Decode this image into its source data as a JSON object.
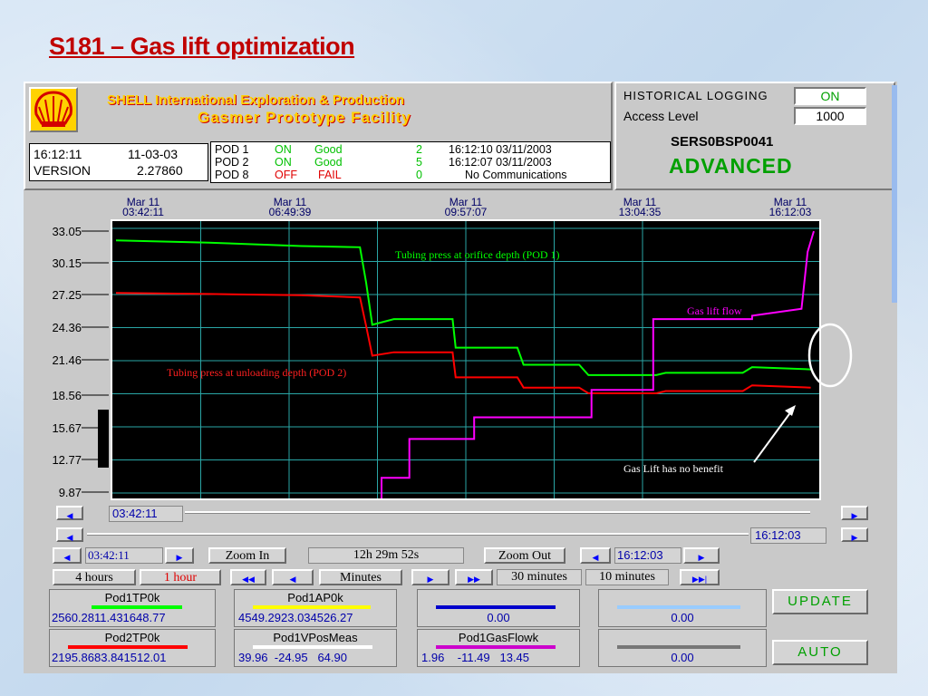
{
  "slide": {
    "title": "S181 – Gas lift optimization"
  },
  "header": {
    "company_line1": "SHELL International Exploration & Production",
    "company_line2": "Gasmer Prototype Facility",
    "time": "16:12:11",
    "date": "11-03-03",
    "version_label": "VERSION",
    "version_value": "2.27860",
    "pods": [
      {
        "name": "POD 1",
        "state": "ON",
        "quality": "Good",
        "count": "2",
        "stamp": "16:12:10 03/11/2003",
        "state_color": "#00c000",
        "quality_color": "#00c000"
      },
      {
        "name": "POD 2",
        "state": "ON",
        "quality": "Good",
        "count": "5",
        "stamp": "16:12:07 03/11/2003",
        "state_color": "#00c000",
        "quality_color": "#00c000"
      },
      {
        "name": "POD 8",
        "state": "OFF",
        "quality": "FAIL",
        "count": "0",
        "stamp": "No Communications",
        "state_color": "#e00000",
        "quality_color": "#e00000"
      }
    ],
    "historical_logging_label": "HISTORICAL LOGGING",
    "historical_logging_value": "ON",
    "access_level_label": "Access Level",
    "access_level_value": "1000",
    "station_id": "SERS0BSP0041",
    "mode": "ADVANCED"
  },
  "chart": {
    "y_ticks": [
      "33.05",
      "30.15",
      "27.25",
      "24.36",
      "21.46",
      "18.56",
      "15.67",
      "12.77",
      "9.87"
    ],
    "x_ticks": [
      {
        "date": "Mar 11",
        "time": "03:42:11"
      },
      {
        "date": "Mar 11",
        "time": "06:49:39"
      },
      {
        "date": "Mar 11",
        "time": "09:57:07"
      },
      {
        "date": "Mar 11",
        "time": "13:04:35"
      },
      {
        "date": "Mar 11",
        "time": "16:12:03"
      }
    ],
    "annotations": {
      "green": "Tubing press at orifice depth (POD 1)",
      "red": "Tubing press at unloading depth (POD 2)",
      "magenta": "Gas lift flow",
      "note": "Gas Lift has no benefit"
    },
    "colors": {
      "green": "#00ff00",
      "red": "#ff0000",
      "magenta": "#ff00ff",
      "grid": "#2aa6a6"
    }
  },
  "chart_data": {
    "type": "line",
    "ylim": [
      9.87,
      33.05
    ],
    "x_hours_range": [
      0,
      12.5
    ],
    "series": [
      {
        "name": "Tubing press at orifice depth (POD 1)",
        "color": "#00ff00",
        "x": [
          0,
          3,
          6,
          7.9,
          8.1,
          8.3,
          9,
          10.9,
          11,
          13,
          13.2,
          15,
          15.3,
          17.5,
          17.8,
          20.3,
          20.6,
          22.5
        ],
        "y": [
          32.0,
          31.8,
          31.5,
          31.4,
          28.3,
          24.6,
          25.1,
          25.1,
          22.6,
          22.6,
          21.1,
          21.1,
          20.2,
          20.2,
          20.4,
          20.4,
          20.9,
          20.7
        ]
      },
      {
        "name": "Tubing press at unloading depth (POD 2)",
        "color": "#ff0000",
        "x": [
          0,
          3,
          6,
          7.9,
          8.1,
          8.3,
          9,
          10.9,
          11,
          13,
          13.2,
          15,
          15.3,
          17.5,
          17.8,
          20.3,
          20.6,
          22.5
        ],
        "y": [
          27.4,
          27.3,
          27.2,
          27.0,
          24.5,
          21.9,
          22.2,
          22.2,
          20.0,
          20.0,
          19.1,
          19.1,
          18.6,
          18.6,
          18.8,
          18.8,
          19.3,
          19.1
        ]
      },
      {
        "name": "Gas lift flow",
        "color": "#ff00ff",
        "x": [
          8.6,
          8.6,
          9.5,
          9.5,
          11.6,
          11.6,
          15.4,
          15.4,
          17.4,
          17.4,
          20.6,
          20.6,
          22.2,
          22.4,
          22.6
        ],
        "y": [
          8.4,
          11.2,
          11.2,
          14.6,
          14.6,
          16.5,
          16.5,
          18.9,
          18.9,
          25.1,
          25.1,
          25.4,
          26.0,
          31.0,
          32.8
        ]
      }
    ]
  },
  "scroll": {
    "start_value": "03:42:11",
    "end_value": "16:12:03"
  },
  "controls": {
    "start_time": "03:42:11",
    "zoom_in": "Zoom In",
    "span": "12h 29m 52s",
    "zoom_out": "Zoom Out",
    "end_time": "16:12:03",
    "range_4h": "4 hours",
    "range_1h": "1 hour",
    "minutes": "Minutes",
    "min30": "30 minutes",
    "min10": "10 minutes",
    "update": "UPDATE",
    "auto": "AUTO"
  },
  "tags": [
    {
      "name": "Pod1TP0k",
      "values": "2560.2811.431648.77",
      "color": "#00ff00"
    },
    {
      "name": "Pod1AP0k",
      "values": "4549.2923.034526.27",
      "color": "#ffff00"
    },
    {
      "name": "",
      "values": "0.00",
      "color": "#0000cc"
    },
    {
      "name": "",
      "values": "0.00",
      "color": "#99ccff"
    },
    {
      "name": "Pod2TP0k",
      "values": "2195.8683.841512.01",
      "color": "#ff0000"
    },
    {
      "name": "Pod1VPosMeas",
      "values": "39.96  -24.95   64.90",
      "color": "#ffffff"
    },
    {
      "name": "Pod1GasFlowk",
      "values": "1.96    -11.49   13.45",
      "color": "#cc00cc"
    },
    {
      "name": "",
      "values": "0.00",
      "color": "#777777"
    }
  ]
}
